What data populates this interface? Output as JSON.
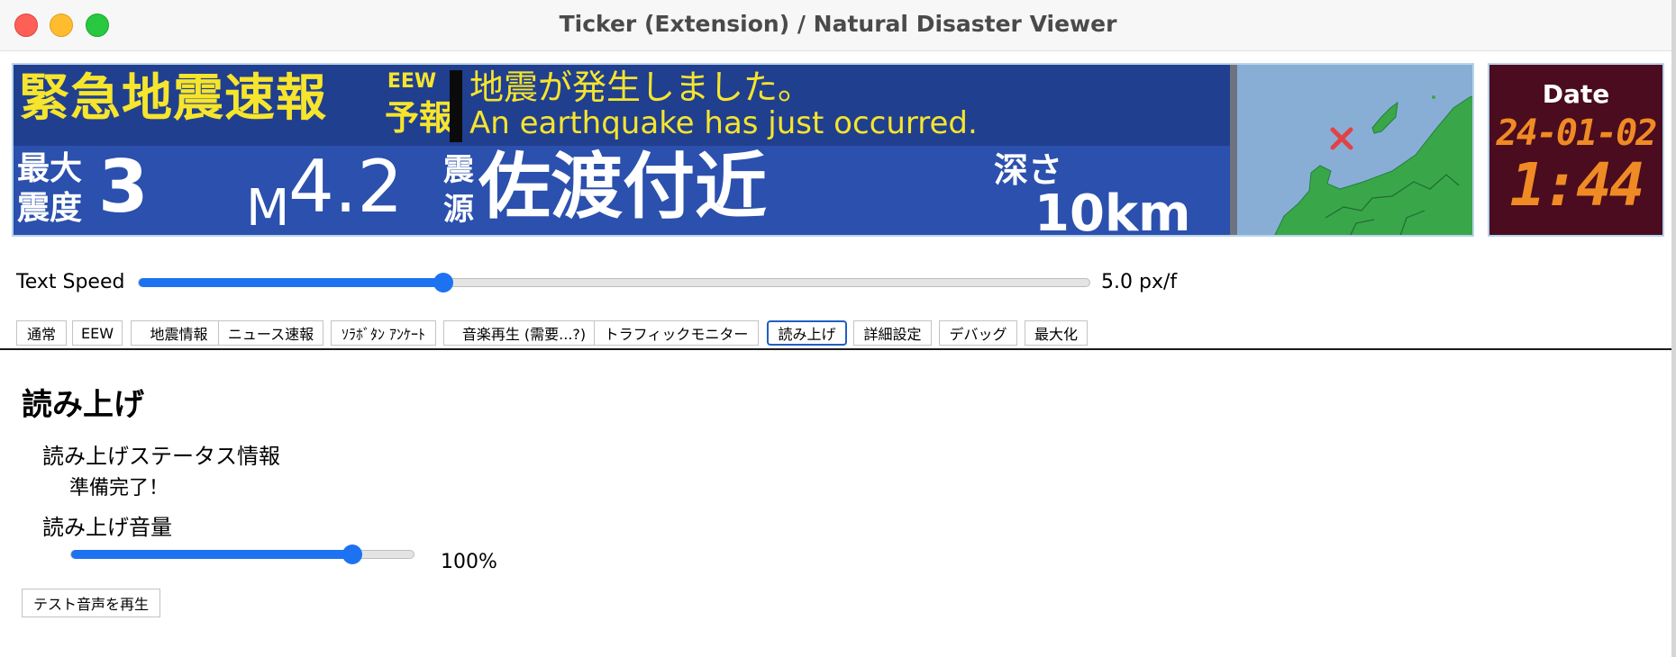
{
  "window": {
    "title": "Ticker (Extension) / Natural Disaster Viewer"
  },
  "banner": {
    "headline": "緊急地震速報",
    "tag": "EEW",
    "tag2": "予報",
    "message_ja": "地震が発生しました。",
    "message_en": "An earthquake has just occurred.",
    "max_intensity_label_1": "最大",
    "max_intensity_label_2": "震度",
    "max_intensity": "3",
    "magnitude_label": "M",
    "magnitude": "4.2",
    "epicenter_label_1": "震",
    "epicenter_label_2": "源",
    "epicenter": "佐渡付近",
    "depth_label": "深さ",
    "depth": "10km",
    "colors": {
      "background": "#2b50ad",
      "headline": "#f6e52c",
      "text": "#ffffff"
    }
  },
  "clock": {
    "label": "Date",
    "date": "24-01-02",
    "time": "1:44",
    "colors": {
      "background": "#4a0c1e",
      "digits": "#f08a24"
    }
  },
  "text_speed": {
    "label": "Text Speed",
    "value_text": "5.0 px/f",
    "level": 0.32
  },
  "tabs": [
    {
      "label": "通常"
    },
    {
      "label": "EEW"
    },
    {
      "label": "地震情報"
    },
    {
      "label": "ニュース速報"
    },
    {
      "label": "ｿﾗﾎﾞﾀﾝ ｱﾝｹｰﾄ"
    },
    {
      "label": "音楽再生 (需要...?)"
    },
    {
      "label": "トラフィックモニター"
    },
    {
      "label": "読み上げ",
      "active": true
    },
    {
      "label": "詳細設定"
    },
    {
      "label": "デバッグ"
    },
    {
      "label": "最大化"
    }
  ],
  "panel": {
    "title": "読み上げ",
    "status_label": "読み上げステータス情報",
    "status_value": "準備完了！",
    "volume_label": "読み上げ音量",
    "volume_value": "100%",
    "volume_level": 0.82,
    "test_button": "テスト音声を再生"
  },
  "accent_color": "#1d72f2"
}
